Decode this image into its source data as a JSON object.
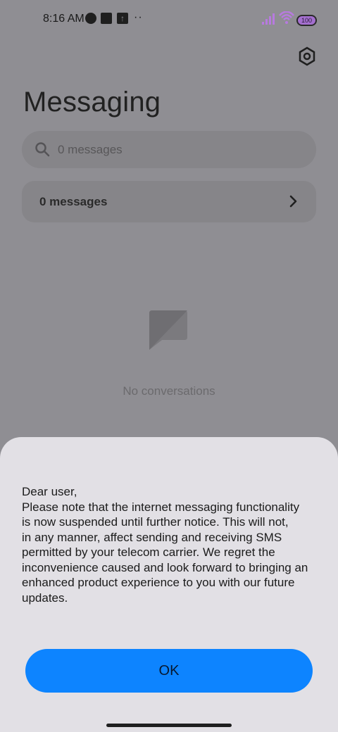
{
  "status_bar": {
    "time": "8:16 AM",
    "icons": [
      "hotspot-icon",
      "square-icon",
      "upload-icon",
      "more-icon",
      "signal-icon",
      "wifi-icon",
      "battery-icon"
    ],
    "more_dots": "··",
    "battery": "100"
  },
  "header": {
    "title": "Messaging",
    "settings_icon": "gear-icon"
  },
  "search": {
    "placeholder": "0 messages",
    "icon": "search-icon"
  },
  "messages_row": {
    "label": "0 messages",
    "icon": "chevron-right-icon"
  },
  "empty_state": {
    "icon": "chat-bubble-icon",
    "text": "No conversations"
  },
  "dialog": {
    "lines": [
      "Dear user,",
      "Please note that the internet messaging functionality",
      "is now suspended until further notice. This will not,",
      "in any manner, affect sending and receiving SMS",
      "permitted by your telecom carrier. We regret the",
      "inconvenience caused and look forward to bringing an",
      "enhanced product experience to you with our future",
      "updates."
    ],
    "ok_label": "OK"
  },
  "colors": {
    "overlay_background": "#8f8e93",
    "sheet_background": "#e2e0e5",
    "primary_button": "#0d84ff",
    "battery": "#a46fcf"
  }
}
